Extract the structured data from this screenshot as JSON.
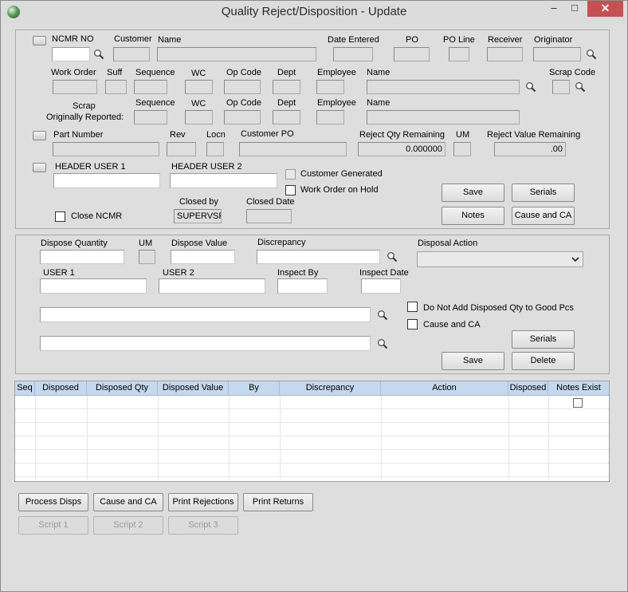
{
  "window": {
    "title": "Quality Reject/Disposition - Update",
    "minimize": "–",
    "maximize": "□",
    "close": "✕"
  },
  "header": {
    "ncmr_no_label": "NCMR NO",
    "customer_label": "Customer",
    "name_label": "Name",
    "date_entered_label": "Date Entered",
    "po_label": "PO",
    "po_line_label": "PO Line",
    "receiver_label": "Receiver",
    "originator_label": "Originator",
    "work_order_label": "Work Order",
    "suff_label": "Suff",
    "sequence_label": "Sequence",
    "wc_label": "WC",
    "op_code_label": "Op Code",
    "dept_label": "Dept",
    "employee_label": "Employee",
    "emp_name_label": "Name",
    "scrap_code_label": "Scrap Code",
    "scrap_label": "Scrap",
    "orig_reported_label": "Originally Reported:",
    "scrap_sequence_label": "Sequence",
    "scrap_wc_label": "WC",
    "scrap_op_code_label": "Op Code",
    "scrap_dept_label": "Dept",
    "scrap_employee_label": "Employee",
    "scrap_name_label": "Name",
    "part_number_label": "Part Number",
    "rev_label": "Rev",
    "locn_label": "Locn",
    "customer_po_label": "Customer PO",
    "reject_qty_label": "Reject Qty Remaining",
    "um_label": "UM",
    "reject_value_label": "Reject Value Remaining",
    "reject_qty_value": "0.000000",
    "reject_value_value": ".00",
    "header_user1_label": "HEADER USER 1",
    "header_user2_label": "HEADER USER 2",
    "customer_generated_label": "Customer Generated",
    "work_order_on_hold_label": "Work Order on Hold",
    "close_ncmr_label": "Close NCMR",
    "closed_by_label": "Closed by",
    "closed_by_value": "SUPERVSR",
    "closed_date_label": "Closed Date",
    "save_button": "Save",
    "serials_button": "Serials",
    "notes_button": "Notes",
    "cause_ca_button": "Cause and CA"
  },
  "disposition": {
    "dispose_qty_label": "Dispose Quantity",
    "um_label": "UM",
    "dispose_value_label": "Dispose Value",
    "discrepancy_label": "Discrepancy",
    "disposal_action_label": "Disposal Action",
    "user1_label": "USER 1",
    "user2_label": "USER 2",
    "inspect_by_label": "Inspect By",
    "inspect_date_label": "Inspect Date",
    "no_add_good_label": "Do Not Add Disposed Qty to Good Pcs",
    "cause_ca_label": "Cause and CA",
    "serials_button": "Serials",
    "save_button": "Save",
    "delete_button": "Delete"
  },
  "grid": {
    "columns": [
      "Seq",
      "Disposed",
      "Disposed Qty",
      "Disposed Value",
      "By",
      "Discrepancy",
      "Action",
      "Disposed",
      "Notes Exist"
    ]
  },
  "footer": {
    "process_disps": "Process Disps",
    "cause_ca": "Cause and CA",
    "print_rejections": "Print Rejections",
    "print_returns": "Print Returns",
    "script1": "Script 1",
    "script2": "Script 2",
    "script3": "Script 3"
  }
}
